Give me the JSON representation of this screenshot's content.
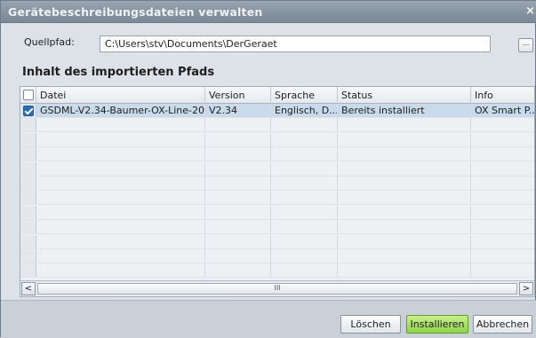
{
  "window": {
    "title": "Gerätebeschreibungsdateien verwalten",
    "close_icon": "×"
  },
  "source": {
    "label": "Quellpfad:",
    "value": "C:\\Users\\stv\\Documents\\DerGeraet",
    "browse_label": "..."
  },
  "section_title": "Inhalt des importierten Pfads",
  "table": {
    "columns": [
      "Datei",
      "Version",
      "Sprache",
      "Status",
      "Info"
    ],
    "rows": [
      {
        "checked": true,
        "cells": [
          "GSDML-V2.34-Baumer-OX-Line-20...",
          "V2.34",
          "Englisch, D...",
          "Bereits installiert",
          "OX Smart P..."
        ]
      }
    ]
  },
  "scrollbar": {
    "left_icon": "<",
    "right_icon": ">",
    "thumb_grip": "III"
  },
  "buttons": {
    "delete": "Löschen",
    "install": "Installieren",
    "cancel": "Abbrechen"
  }
}
